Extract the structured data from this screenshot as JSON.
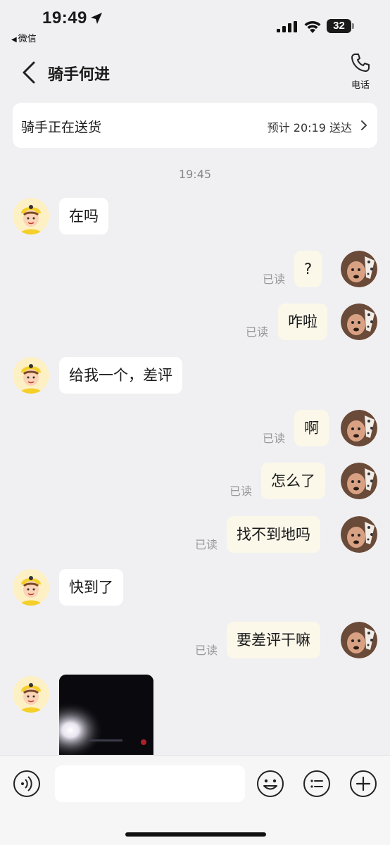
{
  "status_bar": {
    "time": "19:49",
    "back_app": "微信",
    "battery_level": "32"
  },
  "nav": {
    "title": "骑手何进",
    "phone_label": "电话"
  },
  "delivery": {
    "status": "骑手正在送货",
    "eta": "预计 20:19 送达"
  },
  "chat": {
    "timestamp": "19:45",
    "read_label": "已读",
    "messages": [
      {
        "from": "rider",
        "text": "在吗"
      },
      {
        "from": "me",
        "text": "?"
      },
      {
        "from": "me",
        "text": "咋啦"
      },
      {
        "from": "rider",
        "text": "给我一个，差评"
      },
      {
        "from": "me",
        "text": "啊"
      },
      {
        "from": "me",
        "text": "怎么了"
      },
      {
        "from": "me",
        "text": "找不到地吗"
      },
      {
        "from": "rider",
        "text": "快到了"
      },
      {
        "from": "me",
        "text": "要差评干嘛"
      },
      {
        "from": "rider",
        "text": ""
      }
    ]
  },
  "colors": {
    "my_bubble": "#fbf8ea",
    "background": "#f0f0f2",
    "rider_avatar": "#f5cf2a"
  },
  "icons": [
    "location-arrow-icon",
    "signal-icon",
    "wifi-icon",
    "battery-icon",
    "back-chevron-icon",
    "phone-icon",
    "chevron-right-icon",
    "voice-icon",
    "emoji-icon",
    "list-icon",
    "plus-icon"
  ]
}
